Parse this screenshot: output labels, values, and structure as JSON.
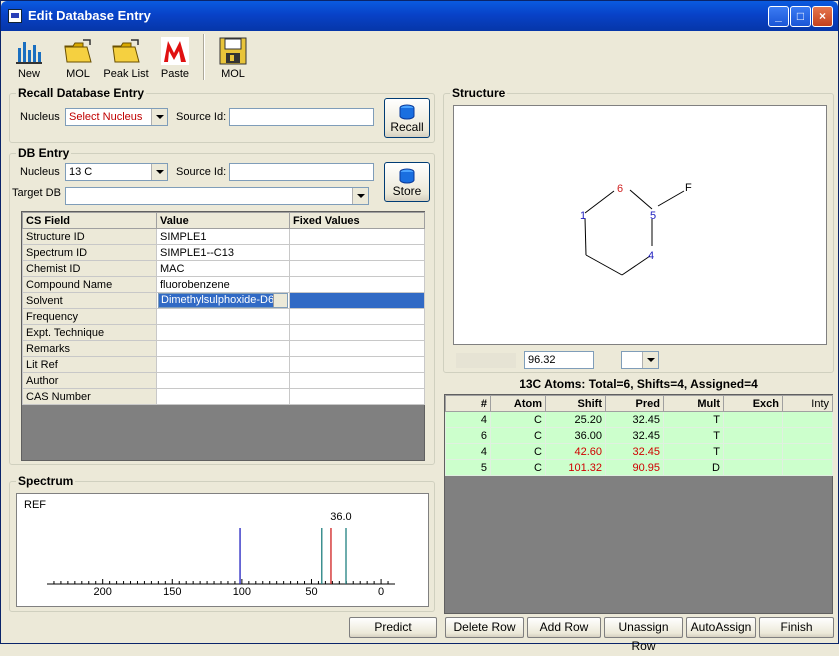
{
  "window": {
    "title": "Edit Database Entry"
  },
  "toolbar": {
    "items": [
      {
        "label": "New",
        "icon": "bar-chart-icon"
      },
      {
        "label": "MOL",
        "icon": "open-folder-icon"
      },
      {
        "label": "Peak List",
        "icon": "open-folder-icon"
      },
      {
        "label": "Paste",
        "icon": "paste-m-icon"
      },
      {
        "label": "MOL",
        "icon": "floppy-disk-icon"
      }
    ]
  },
  "recall": {
    "title": "Recall Database Entry",
    "nucleus_label": "Nucleus",
    "nucleus_value": "Select Nucleus",
    "source_label": "Source Id:",
    "source_value": "",
    "button": "Recall"
  },
  "dbentry": {
    "title": "DB Entry",
    "nucleus_label": "Nucleus",
    "nucleus_value": "13 C",
    "source_label": "Source Id:",
    "source_value": "",
    "target_label": "Target DB",
    "target_value": "",
    "button": "Store",
    "columns": [
      "CS Field",
      "Value",
      "Fixed Values"
    ],
    "rows": [
      {
        "field": "Structure ID",
        "value": "SIMPLE1"
      },
      {
        "field": "Spectrum ID",
        "value": "SIMPLE1--C13"
      },
      {
        "field": "Chemist ID",
        "value": "MAC"
      },
      {
        "field": "Compound Name",
        "value": "fluorobenzene"
      },
      {
        "field": "Solvent",
        "value": "Dimethylsulphoxide-D6"
      },
      {
        "field": "Frequency",
        "value": ""
      },
      {
        "field": "Expt. Technique",
        "value": ""
      },
      {
        "field": "Remarks",
        "value": ""
      },
      {
        "field": "Lit Ref",
        "value": ""
      },
      {
        "field": "Author",
        "value": ""
      },
      {
        "field": "CAS Number",
        "value": ""
      }
    ]
  },
  "spectrum": {
    "title": "Spectrum",
    "ref_label": "REF",
    "peak_label": "36.0",
    "ticks": [
      "200",
      "150",
      "100",
      "50",
      "0"
    ],
    "peaks": [
      {
        "ppm": 101.32,
        "color": "#2020c0"
      },
      {
        "ppm": 42.6,
        "color": "#208080"
      },
      {
        "ppm": 36.0,
        "color": "#d02020"
      },
      {
        "ppm": 25.2,
        "color": "#208080"
      }
    ],
    "xlim": [
      240,
      -10
    ]
  },
  "structure": {
    "title": "Structure",
    "atoms": [
      {
        "label": "1",
        "color": "#2020c0"
      },
      {
        "label": "6",
        "color": "#d02020"
      },
      {
        "label": "5",
        "color": "#2020c0"
      },
      {
        "label": "F",
        "color": "#000000"
      },
      {
        "label": "4",
        "color": "#2020c0"
      }
    ],
    "value_field": "96.32",
    "combo_value": ""
  },
  "atoms_table": {
    "summary": "13C Atoms: Total=6, Shifts=4, Assigned=4",
    "columns": [
      "#",
      "Atom",
      "Shift",
      "Pred",
      "Mult",
      "Exch",
      "Inty"
    ],
    "rows": [
      {
        "num": "4",
        "atom": "C",
        "shift": "25.20",
        "pred": "32.45",
        "mult": "T",
        "exch": "",
        "inty": "",
        "red": false
      },
      {
        "num": "6",
        "atom": "C",
        "shift": "36.00",
        "pred": "32.45",
        "mult": "T",
        "exch": "",
        "inty": "",
        "red": false
      },
      {
        "num": "4",
        "atom": "C",
        "shift": "42.60",
        "pred": "32.45",
        "mult": "T",
        "exch": "",
        "inty": "",
        "red": true
      },
      {
        "num": "5",
        "atom": "C",
        "shift": "101.32",
        "pred": "90.95",
        "mult": "D",
        "exch": "",
        "inty": "",
        "red": true
      }
    ]
  },
  "buttons": {
    "predict": "Predict",
    "delete_row": "Delete Row",
    "add_row": "Add Row",
    "unassign_row": "Unassign Row",
    "autoassign": "AutoAssign",
    "finish": "Finish"
  }
}
